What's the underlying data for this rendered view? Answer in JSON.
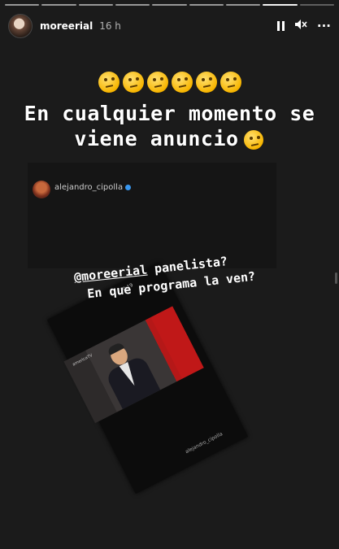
{
  "header": {
    "username": "moreerial",
    "time": "16 h",
    "pause_icon": "pause-icon",
    "mute_icon": "speaker-muted-icon",
    "more_label": "···",
    "segments": [
      1,
      1,
      1,
      1,
      1,
      1,
      1,
      2,
      0
    ]
  },
  "story": {
    "emoji_count": 6,
    "caption_line1": "En cualquier momento se",
    "caption_line2": "viene anuncio"
  },
  "repost": {
    "username": "alejandro_cipolla"
  },
  "card": {
    "time_label": "0:19",
    "video_logo": "americaTV",
    "handle": "alejandro_cipolla"
  },
  "overlay": {
    "mention": "@moreerial",
    "line1_rest": " panelista?",
    "line2": "En que programa la ven?"
  }
}
